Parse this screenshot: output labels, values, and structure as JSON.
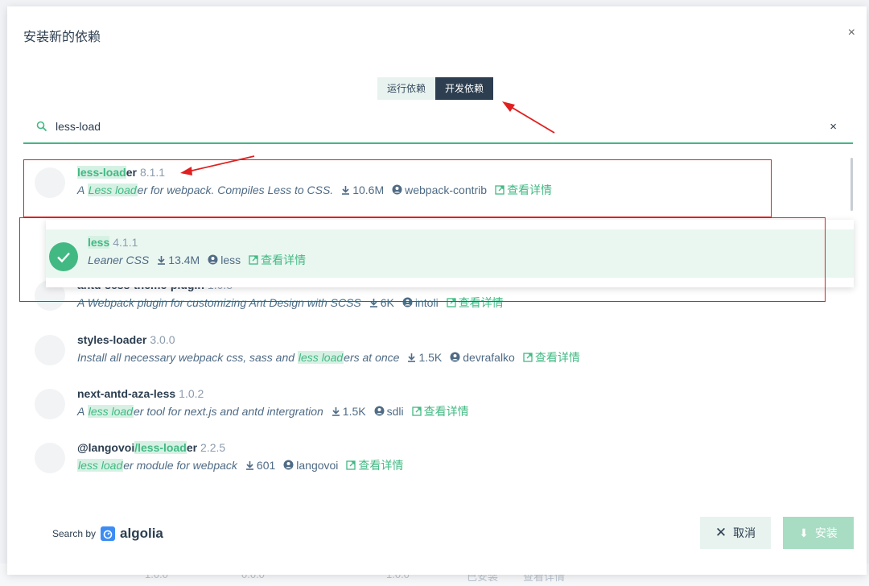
{
  "background_row": {
    "v1": "1.0.0",
    "v2": "0.0.0",
    "v3": "1.0.0",
    "v4": "已安装",
    "v5": "查看详情"
  },
  "dialog": {
    "title": "安装新的依赖",
    "close": "×"
  },
  "segmented": {
    "run": "运行依赖",
    "dev": "开发依赖"
  },
  "search": {
    "value": "less-load",
    "clear": "×"
  },
  "results": [
    {
      "name_hl": "less-load",
      "name_rest": "er",
      "version": "8.1.1",
      "desc_pre": "A ",
      "desc_hl": "Less load",
      "desc_post": "er for webpack. Compiles Less to CSS.",
      "downloads": "10.6M",
      "author": "webpack-contrib",
      "details": "查看详情"
    },
    {
      "name": "antd-scss-theme-plugin",
      "version": "1.0.8",
      "desc": "A Webpack plugin for customizing Ant Design with SCSS",
      "downloads": "6K",
      "author": "intoli",
      "details": "查看详情"
    },
    {
      "name": "styles-loader",
      "version": "3.0.0",
      "desc_pre": "Install all necessary webpack css, sass and ",
      "desc_hl": "less load",
      "desc_post": "ers at once",
      "downloads": "1.5K",
      "author": "devrafalko",
      "details": "查看详情"
    },
    {
      "name": "next-antd-aza-less",
      "version": "1.0.2",
      "desc_pre": "A ",
      "desc_hl": "less load",
      "desc_post": "er tool for next.js and antd intergration",
      "downloads": "1.5K",
      "author": "sdli",
      "details": "查看详情"
    },
    {
      "name_pre": "@langovoi",
      "name_hl": "/less-load",
      "name_rest": "er",
      "version": "2.2.5",
      "desc_hl": "less load",
      "desc_post": "er module for webpack",
      "downloads": "601",
      "author": "langovoi",
      "details": "查看详情"
    }
  ],
  "selected": {
    "name": "less",
    "version": "4.1.1",
    "desc": "Leaner CSS",
    "downloads": "13.4M",
    "author": "less",
    "details": "查看详情"
  },
  "footer": {
    "search_by": "Search by",
    "brand": "algolia",
    "cancel": "取消",
    "install": "安装"
  },
  "colors": {
    "accent": "#42b983",
    "dark": "#2c3e50",
    "annotation": "#e02020"
  }
}
